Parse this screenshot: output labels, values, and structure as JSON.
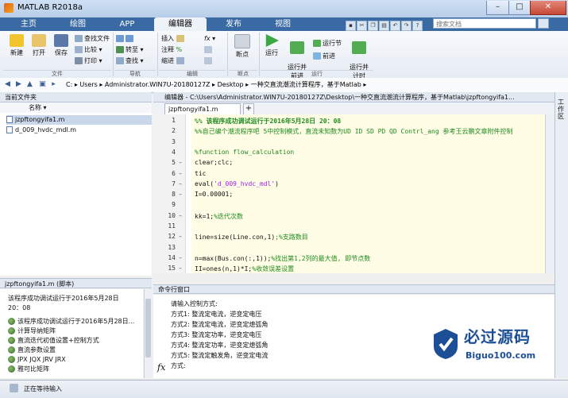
{
  "window": {
    "title": "MATLAB R2018a",
    "controls": [
      "–",
      "□",
      "✕"
    ]
  },
  "tabs": [
    {
      "label": "主页"
    },
    {
      "label": "绘图"
    },
    {
      "label": "APP"
    },
    {
      "label": "编辑器",
      "active": true
    },
    {
      "label": "发布"
    },
    {
      "label": "视图"
    }
  ],
  "search": {
    "placeholder": "搜索文档"
  },
  "ribbon": {
    "file": {
      "new": "新建",
      "open": "打开",
      "save": "保存",
      "find_files": "查找文件",
      "compare": "比较",
      "print": "打印",
      "group": "文件"
    },
    "navigate": {
      "goto": "转至",
      "find": "查找",
      "group": "导航"
    },
    "edit": {
      "insert": "插入",
      "comment": "注释",
      "indent": "缩进",
      "fx": "fx",
      "group": "编辑"
    },
    "breakpoints": {
      "label": "断点",
      "group": "断点"
    },
    "run": {
      "run": "运行",
      "run_advance": "运行并\n前进",
      "run_section": "运行节",
      "advance": "前进",
      "run_time": "运行并\n计时",
      "group": "运行"
    }
  },
  "address": {
    "path": "C: ▸ Users ▸ Administrator.WIN7U-20180127Z ▸ Desktop ▸ 一种交直流潮流计算程序，基于Matlab ▸"
  },
  "current_folder": {
    "title": "当前文件夹",
    "column": "名称 ▾",
    "files": [
      {
        "name": "jzpftongyifa1.m",
        "selected": true
      },
      {
        "name": "d_009_hvdc_mdl.m",
        "selected": false
      }
    ]
  },
  "details": {
    "title": "jzpftongyifa1.m  (脚本)",
    "summary_line1": "该程序成功调试运行于2016年5月28日",
    "summary_line2": "20：08",
    "items": [
      "该程序成功调试运行于2016年5月28日...",
      "计算导纳矩阵",
      "直流迭代初值设置+控制方式",
      "直流参数设置",
      "JPX JQX JRV JRX",
      "雅可比矩阵"
    ]
  },
  "editor": {
    "header": "编辑器 - C:\\Users\\Administrator.WIN7U-20180127Z\\Desktop\\一种交直流潮流计算程序，基于Matlab\\jzpftongyifa1...",
    "tab": "jzpftongyifa1.m",
    "add": "+",
    "lines": [
      {
        "n": "1",
        "dash": "",
        "text": "%%  该程序成功调试运行于2016年5月28日 20：08",
        "cls": "cmt bold"
      },
      {
        "n": "2",
        "dash": "",
        "text": "%%自己编个潮流程序吧 5中控制模式，直流未知数为UD ID SD PD QD Contrl_ang 参考王云鹏文章附件控制",
        "cls": "cmt"
      },
      {
        "n": "3",
        "dash": "",
        "text": "",
        "cls": ""
      },
      {
        "n": "4",
        "dash": "",
        "text": "%function flow_calculation",
        "cls": "cmt"
      },
      {
        "n": "5",
        "dash": "–",
        "text": "clear;clc;",
        "cls": ""
      },
      {
        "n": "6",
        "dash": "–",
        "text": "tic",
        "cls": ""
      },
      {
        "n": "7",
        "dash": "–",
        "text": "eval('d_009_hvdc_mdl')",
        "cls": "",
        "has_str": true
      },
      {
        "n": "8",
        "dash": "–",
        "text": "I=0.00001;",
        "cls": ""
      },
      {
        "n": "9",
        "dash": "",
        "text": "",
        "cls": ""
      },
      {
        "n": "10",
        "dash": "–",
        "text": "kk=1;%迭代次数",
        "cls": "",
        "split": [
          5
        ]
      },
      {
        "n": "11",
        "dash": "",
        "text": "",
        "cls": ""
      },
      {
        "n": "12",
        "dash": "–",
        "text": "line=size(Line.con,1);%支路数目",
        "cls": "",
        "split": [
          21
        ]
      },
      {
        "n": "13",
        "dash": "",
        "text": "",
        "cls": ""
      },
      {
        "n": "14",
        "dash": "–",
        "text": "n=max(Bus.con(:,1));%找出第1,2列的最大值, 即节点数",
        "cls": "",
        "split": [
          20
        ]
      },
      {
        "n": "15",
        "dash": "–",
        "text": "II=ones(n,1)*I;%收敛误差设置",
        "cls": "",
        "split": [
          15
        ]
      }
    ]
  },
  "workspace": {
    "label": "工作区"
  },
  "command_window": {
    "title": "命令行窗口",
    "lines": [
      "请输入控制方式:",
      "方式1: 整流定电流，逆变定电压",
      "方式2: 整流定电流，逆变定熄弧角",
      "方式3: 整流定功率，逆变定电压",
      "方式4: 整流定功率，逆变定熄弧角",
      "方式5: 整流定触发角，逆变定电流",
      "方式:"
    ],
    "prompt_icon": "fx"
  },
  "watermark": {
    "title": "必过源码",
    "url": "Biguo100.com"
  },
  "status": {
    "text": "正在等待输入"
  },
  "colors": {
    "tabstrip": "#3a6aa3",
    "code_bg": "#fffde5",
    "comment": "#1f8a1f",
    "string": "#a020f0"
  }
}
